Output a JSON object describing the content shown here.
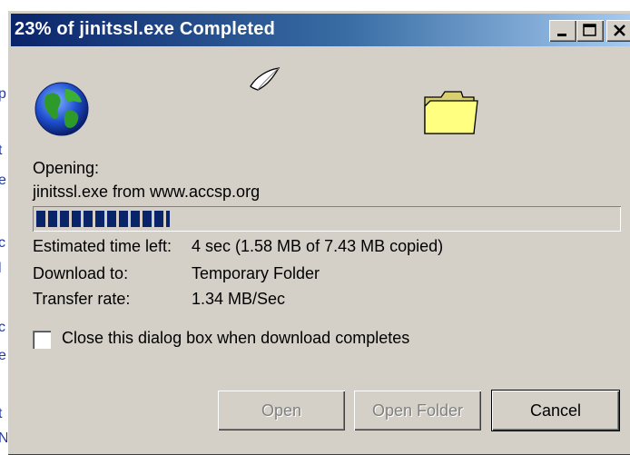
{
  "background": {
    "fragments": [
      "p",
      "t",
      "e",
      "c",
      "l",
      "c",
      "e",
      "t",
      "N"
    ]
  },
  "window": {
    "title": "23% of jinitssl.exe Completed",
    "controls": {
      "minimize_icon": "minimize-icon",
      "maximize_icon": "maximize-icon",
      "close_icon": "close-icon"
    }
  },
  "icons": {
    "source": "globe-icon",
    "transfer": "flying-paper-icon",
    "destination": "folder-icon"
  },
  "status": {
    "opening_label": "Opening:",
    "file_line": "jinitssl.exe from www.accsp.org",
    "progress_percent": 23
  },
  "details": {
    "estimated_label": "Estimated time left:",
    "estimated_value": "4 sec (1.58 MB of 7.43 MB copied)",
    "download_to_label": "Download to:",
    "download_to_value": "Temporary Folder",
    "transfer_rate_label": "Transfer rate:",
    "transfer_rate_value": "1.34 MB/Sec"
  },
  "options": {
    "close_when_done_label": "Close this dialog box when download completes",
    "close_when_done_checked": false
  },
  "buttons": {
    "open": "Open",
    "open_folder": "Open Folder",
    "cancel": "Cancel"
  },
  "colors": {
    "title_gradient_start": "#0a246a",
    "title_gradient_end": "#a6caf0",
    "dialog_face": "#d4d0c8",
    "progress_block": "#0a246a"
  }
}
